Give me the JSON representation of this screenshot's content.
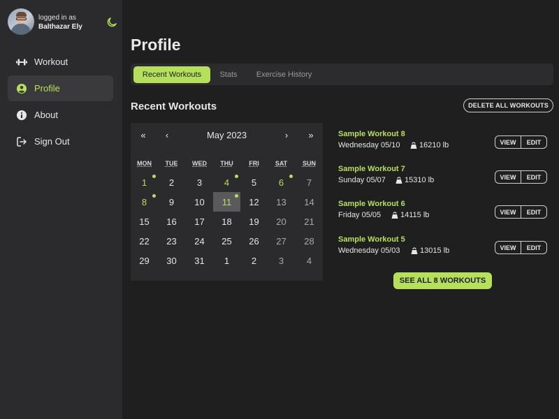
{
  "user": {
    "logged_in_label": "logged in as",
    "name": "Balthazar Ely"
  },
  "sidebar": {
    "items": [
      {
        "label": "Workout",
        "icon": "dumbbell-icon",
        "active": false
      },
      {
        "label": "Profile",
        "icon": "user-circle-icon",
        "active": true
      },
      {
        "label": "About",
        "icon": "info-icon",
        "active": false
      },
      {
        "label": "Sign Out",
        "icon": "sign-out-icon",
        "active": false
      }
    ]
  },
  "page": {
    "title": "Profile"
  },
  "tabs": [
    {
      "label": "Recent Workouts",
      "active": true
    },
    {
      "label": "Stats",
      "active": false
    },
    {
      "label": "Exercise History",
      "active": false
    }
  ],
  "recent": {
    "title": "Recent Workouts",
    "delete_all_label": "DELETE ALL WORKOUTS",
    "see_all_label": "SEE ALL 8 WORKOUTS"
  },
  "calendar": {
    "prev_year": "«",
    "prev_month": "‹",
    "month_label": "May 2023",
    "next_month": "›",
    "next_year": "»",
    "weekdays": [
      "MON",
      "TUE",
      "WED",
      "THU",
      "FRI",
      "SAT",
      "SUN"
    ],
    "weeks": [
      [
        "1",
        "2",
        "3",
        "4",
        "5",
        "6",
        "7"
      ],
      [
        "8",
        "9",
        "10",
        "11",
        "12",
        "13",
        "14"
      ],
      [
        "15",
        "16",
        "17",
        "18",
        "19",
        "20",
        "21"
      ],
      [
        "22",
        "23",
        "24",
        "25",
        "26",
        "27",
        "28"
      ],
      [
        "29",
        "30",
        "31",
        "1",
        "2",
        "3",
        "4"
      ]
    ]
  },
  "workouts": [
    {
      "name": "Sample Workout 8",
      "date": "Wednesday 05/10",
      "weight": "16210 lb",
      "view_label": "VIEW",
      "edit_label": "EDIT"
    },
    {
      "name": "Sample Workout 7",
      "date": "Sunday 05/07",
      "weight": "15310 lb",
      "view_label": "VIEW",
      "edit_label": "EDIT"
    },
    {
      "name": "Sample Workout 6",
      "date": "Friday 05/05",
      "weight": "14115 lb",
      "view_label": "VIEW",
      "edit_label": "EDIT"
    },
    {
      "name": "Sample Workout 5",
      "date": "Wednesday 05/03",
      "weight": "13015 lb",
      "view_label": "VIEW",
      "edit_label": "EDIT"
    }
  ],
  "colors": {
    "accent": "#b7e05a",
    "sidebar": "#2b2b2d",
    "background": "#1f1f1f"
  }
}
